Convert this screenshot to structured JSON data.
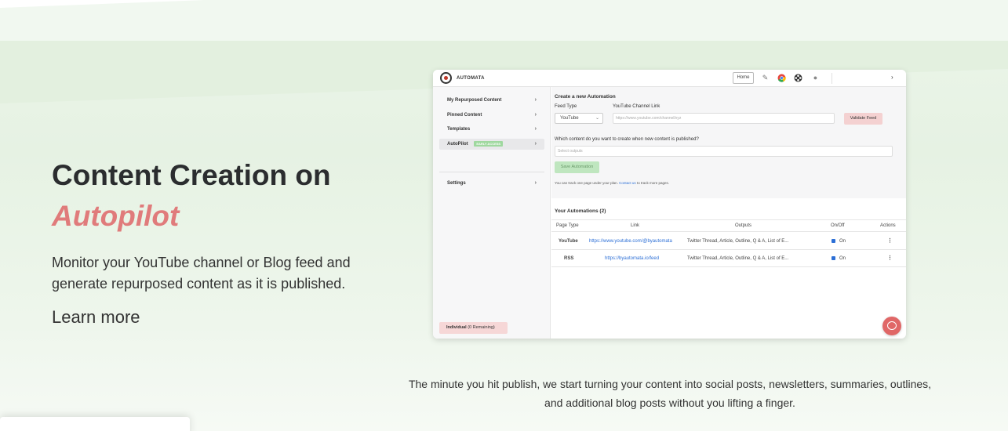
{
  "hero": {
    "title_line1": "Content Creation on",
    "title_accent": "Autopilot",
    "description": "Monitor your YouTube channel or Blog feed and generate repurposed content as it is published.",
    "learn_more": "Learn more"
  },
  "caption": "The minute you hit publish, we start turning your content into social posts, newsletters, summaries, outlines, and additional blog posts without you lifting a finger.",
  "app": {
    "brand": "AUTOMATA",
    "header": {
      "home_label": "Home"
    },
    "sidebar": {
      "items": [
        {
          "label": "My Repurposed Content"
        },
        {
          "label": "Pinned Content"
        },
        {
          "label": "Templates"
        },
        {
          "label": "AutoPilot",
          "badge": "EARLY ACCESS"
        },
        {
          "label": "Settings"
        }
      ],
      "plan_name": "Individual",
      "plan_remaining": "(0 Remaining)"
    },
    "create": {
      "title": "Create a new Automation",
      "feed_type_label": "Feed Type",
      "feed_type_value": "YouTube",
      "channel_link_label": "YouTube Channel Link",
      "channel_link_placeholder": "https://www.youtube.com/channel/xyz",
      "validate_label": "Validate Feed",
      "question": "Which content do you want to create when new content is published?",
      "outputs_placeholder": "Select outputs",
      "save_label": "Save Automation",
      "note_prefix": "You can track one page under your plan.",
      "note_link": "Contact us",
      "note_suffix": "to track more pages."
    },
    "automations": {
      "title": "Your Automations (2)",
      "columns": [
        "Page Type",
        "Link",
        "Outputs",
        "On/Off",
        "Actions"
      ],
      "rows": [
        {
          "page_type": "YouTube",
          "link": "https://www.youtube.com/@byautomata",
          "outputs": "Twitter Thread, Article, Outline, Q & A, List of E...",
          "status": "On",
          "actions": "⋮"
        },
        {
          "page_type": "RSS",
          "link": "https://byautomata.io/feed",
          "outputs": "Twitter Thread, Article, Outline, Q & A, List of E...",
          "status": "On",
          "actions": "⋮"
        }
      ]
    }
  },
  "colors": {
    "accent": "#e07b7b",
    "link": "#2c6fd6",
    "save_button": "#bfe6bf",
    "validate_button": "#f4d1d1"
  },
  "icons": [
    "logo-icon",
    "pin-icon",
    "chrome-icon",
    "extension-icon",
    "bulb-icon",
    "chevron-right-icon",
    "chat-icon"
  ]
}
